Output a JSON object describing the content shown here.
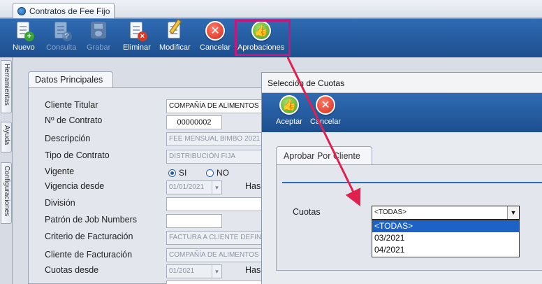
{
  "window": {
    "tab_title": "Contratos de Fee Fijo"
  },
  "toolbar": {
    "nuevo": "Nuevo",
    "consulta": "Consulta",
    "grabar": "Grabar",
    "eliminar": "Eliminar",
    "modificar": "Modificar",
    "cancelar": "Cancelar",
    "aprobaciones": "Aprobaciones"
  },
  "side_tabs": [
    "Herramientas",
    "Ayuda",
    "Configuraciones"
  ],
  "form": {
    "tab": "Datos Principales",
    "cliente_titular": {
      "label": "Cliente Titular",
      "value": "COMPAÑÍA DE ALIMENTOS F"
    },
    "numero_contrato": {
      "label": "Nº de Contrato",
      "value": "00000002"
    },
    "descripcion": {
      "label": "Descripción",
      "value": "FEE MENSUAL BIMBO 2021"
    },
    "tipo_contrato": {
      "label": "Tipo de Contrato",
      "value": "DISTRIBUCIÓN FIJA"
    },
    "vigente": {
      "label": "Vigente",
      "option_si": "SI",
      "option_no": "NO",
      "selected": "SI"
    },
    "vigencia_desde": {
      "label": "Vigencia desde",
      "value": "01/01/2021",
      "hasta": "Has"
    },
    "division": {
      "label": "División",
      "value": ""
    },
    "patron_job": {
      "label": "Patrón de Job Numbers",
      "value": ""
    },
    "criterio_facturacion": {
      "label": "Criterio de Facturación",
      "value": "FACTURA A CLIENTE DEFINI"
    },
    "cliente_facturacion": {
      "label": "Cliente de Facturación",
      "value": "COMPAÑÍA DE ALIMENTOS F"
    },
    "cuotas_desde": {
      "label": "Cuotas desde",
      "value": "01/2021",
      "hasta": "Has"
    }
  },
  "dialog": {
    "title": "Selección de Cuotas",
    "aceptar": "Aceptar",
    "cancelar": "Cancelar",
    "tab": "Aprobar Por Cliente",
    "cuotas_label": "Cuotas",
    "combo_value": "<TODAS>",
    "options": [
      "<TODAS>",
      "03/2021",
      "04/2021"
    ],
    "selected_option": "<TODAS>"
  },
  "colors": {
    "toolbar_blue": "#2a62a8",
    "highlight": "#c4167d",
    "arrow": "#e0204f",
    "selection": "#1d63c7"
  }
}
